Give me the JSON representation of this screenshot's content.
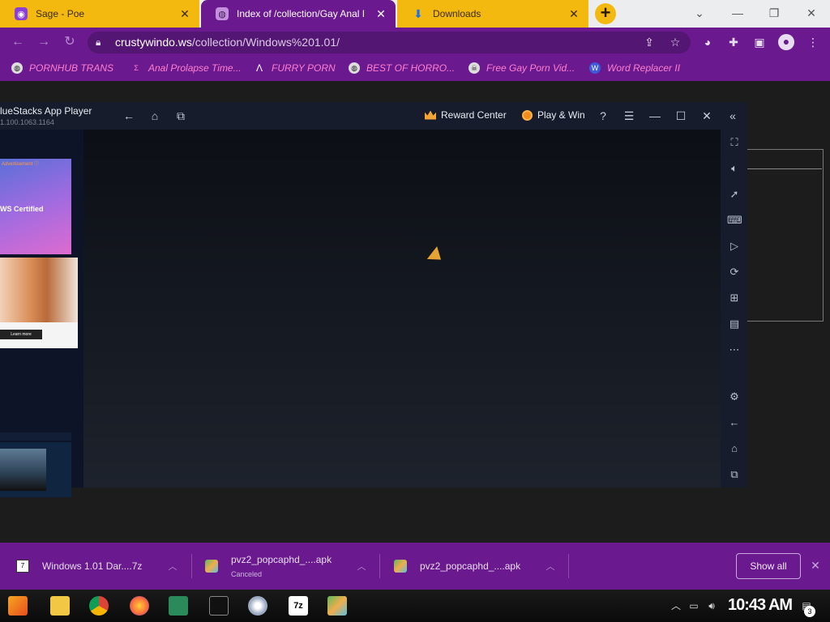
{
  "browser": {
    "tabs": [
      {
        "title": "Sage - Poe",
        "icon": "poe-icon",
        "close": "✕"
      },
      {
        "title": "Index of /collection/Gay Anal I",
        "icon": "globe-icon",
        "close": "✕"
      },
      {
        "title": "Downloads",
        "icon": "download-icon",
        "close": "✕"
      }
    ],
    "new_tab": "+",
    "window_controls": {
      "list": "⌄",
      "minimize": "—",
      "restore": "❐",
      "close": "✕"
    },
    "address": {
      "host": "crustywindo.ws",
      "path": "/collection/Windows%201.01/"
    },
    "bookmarks": [
      {
        "label": "PORNHUB TRANS",
        "icon": "globe-icon"
      },
      {
        "label": "Anal Prolapse Time...",
        "icon": "bookmark-icon"
      },
      {
        "label": "FURRY PORN",
        "icon": "arrow-logo-icon"
      },
      {
        "label": "BEST OF HORRO...",
        "icon": "globe-icon"
      },
      {
        "label": "Free Gay Porn Vid...",
        "icon": "skull-icon"
      },
      {
        "label": "Word Replacer II",
        "icon": "wr-icon"
      }
    ]
  },
  "bluestacks": {
    "title": "lueStacks App Player",
    "version": "1.100.1063.1164",
    "reward_center": "Reward Center",
    "play_win": "Play & Win",
    "ad1": {
      "label": "Advertisement ⓘ",
      "text": "WS Certified"
    },
    "ad2": {
      "button": "Learn more"
    },
    "sidebar_icons": [
      "fullscreen-icon",
      "volume-icon",
      "cursor-icon",
      "keyboard-icon",
      "macro-icon",
      "rotate-icon",
      "robot-icon",
      "apk-icon",
      "more-icon",
      "settings-icon",
      "back-icon",
      "home-icon",
      "recents-icon"
    ]
  },
  "downloads": {
    "items": [
      {
        "name": "Windows 1.01 Dar....7z",
        "status": "",
        "icon": "7z-file-icon"
      },
      {
        "name": "pvz2_popcaphd_....apk",
        "status": "Canceled",
        "icon": "apk-file-icon"
      },
      {
        "name": "pvz2_popcaphd_....apk",
        "status": "",
        "icon": "apk-file-icon"
      }
    ],
    "show_all": "Show all",
    "close": "✕"
  },
  "taskbar": {
    "time": "10:43 AM",
    "notifications": "3"
  },
  "colors": {
    "browser_purple": "#6a1a8e",
    "tab_yellow": "#f3b90f",
    "bookmark_pink": "#ff7fd0",
    "bluestacks_bg": "#101521"
  }
}
